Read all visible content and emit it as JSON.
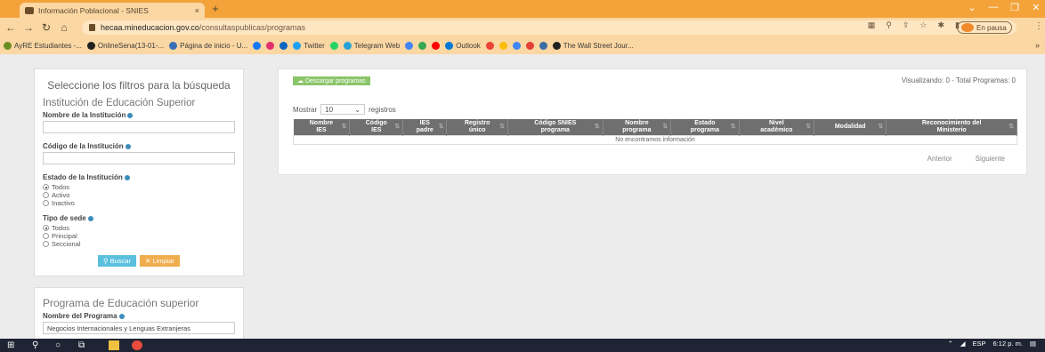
{
  "browser": {
    "tab_title": "Información Poblacional - SNIES",
    "tab_close": "×",
    "new_tab": "+",
    "url_host": "hecaa.mineducacion.gov.co",
    "url_path": "/consultaspublicas/programas",
    "profile_status": "En pausa",
    "window_controls": [
      "minimize-icon",
      "restore-icon",
      "close-icon"
    ],
    "accent": "#f3a33a",
    "bookmarks": [
      {
        "label": "AyRE Estudiantes -...",
        "color": "#6b8e23"
      },
      {
        "label": "OnlineSena(13-01-...",
        "color": "#222222"
      },
      {
        "label": "Página de inicio - U...",
        "color": "#3b6fb6"
      },
      {
        "label": "",
        "color": "#1877f2"
      },
      {
        "label": "",
        "color": "#e1306c"
      },
      {
        "label": "",
        "color": "#0a66c2"
      },
      {
        "label": "Twitter",
        "color": "#1da1f2"
      },
      {
        "label": "",
        "color": "#25d366"
      },
      {
        "label": "Telegram Web",
        "color": "#2aa1da"
      },
      {
        "label": "",
        "color": "#4285f4"
      },
      {
        "label": "",
        "color": "#34a853"
      },
      {
        "label": "",
        "color": "#ff0000"
      },
      {
        "label": "Outlook",
        "color": "#0078d4"
      },
      {
        "label": "",
        "color": "#ea4335"
      },
      {
        "label": "",
        "color": "#fbbc04"
      },
      {
        "label": "",
        "color": "#4285f4"
      },
      {
        "label": "",
        "color": "#e34133"
      },
      {
        "label": "",
        "color": "#3a6ea5"
      },
      {
        "label": "The Wall Street Jour...",
        "color": "#222222"
      }
    ]
  },
  "sidebar": {
    "filters_title": "Seleccione los filtros para la búsqueda",
    "institution_section": "Institución de Educación Superior",
    "institution_name_label": "Nombre de la Institución",
    "institution_code_label": "Código de la Institución",
    "institution_state_label": "Estado de la Institución",
    "state_options": [
      "Todos",
      "Activo",
      "Inactivo"
    ],
    "sede_label": "Tipo de sede",
    "sede_options": [
      "Todos",
      "Principal",
      "Seccional"
    ],
    "search_button": "Buscar",
    "clear_button": "Limpiar",
    "program_section": "Programa de Educación superior",
    "program_name_label": "Nombre del Programa",
    "program_name_value": "Negocios Internacionales y Lenguas Extranjeras"
  },
  "main": {
    "download_button": "Descargar programas",
    "summary": "Visualizando: 0 - Total Programas: 0",
    "show_label": "Mostrar",
    "page_size": "10",
    "records_label": "registros",
    "columns": [
      {
        "line1": "Nombre",
        "line2": "IES"
      },
      {
        "line1": "Código",
        "line2": "IES"
      },
      {
        "line1": "IES",
        "line2": "padre"
      },
      {
        "line1": "Registro",
        "line2": "único"
      },
      {
        "line1": "Código SNIES",
        "line2": "programa"
      },
      {
        "line1": "Nombre",
        "line2": "programa"
      },
      {
        "line1": "Estado",
        "line2": "programa"
      },
      {
        "line1": "Nivel",
        "line2": "académico"
      },
      {
        "line1": "Modalidad",
        "line2": ""
      },
      {
        "line1": "Reconocimiento del",
        "line2": "Ministerio"
      }
    ],
    "empty_message": "No encontramos información",
    "prev_label": "Anterior",
    "next_label": "Siguiente"
  },
  "taskbar": {
    "language": "ESP",
    "time": "6:12 p. m."
  }
}
